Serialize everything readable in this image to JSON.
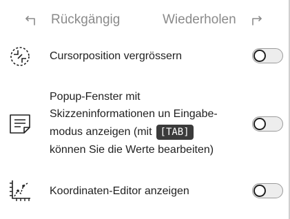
{
  "toolbar": {
    "undo_label": "Rückgängig",
    "redo_label": "Wiederholen",
    "undo_icon": "undo-arrow-icon",
    "redo_icon": "redo-arrow-icon"
  },
  "settings": [
    {
      "icon": "cursor-magnify-icon",
      "label": "Cursorposition vergrössern",
      "enabled": false
    },
    {
      "icon": "popup-info-icon",
      "label_lines": [
        "Popup-Fenster mit",
        "Skizzeninformationen un Eingabe-",
        "modus anzeigen (mit"
      ],
      "key_badge": "[TAB]",
      "label_tail": "können Sie die Werte bearbeiten)",
      "enabled": false
    },
    {
      "icon": "coordinate-editor-icon",
      "label": "Koordinaten-Editor anzeigen",
      "enabled": false
    }
  ],
  "colors": {
    "text": "#1f1f1f",
    "muted": "#8a8a8a",
    "badge_bg": "#3b3b3b",
    "toggle_off": "#ededed"
  }
}
